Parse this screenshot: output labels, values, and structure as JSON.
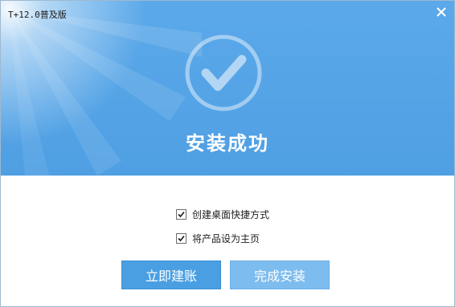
{
  "window": {
    "title": "T+12.0普及版"
  },
  "banner": {
    "headline": "安装成功"
  },
  "options": [
    {
      "label": "创建桌面快捷方式",
      "checked": true
    },
    {
      "label": "将产品设为主页",
      "checked": true
    }
  ],
  "buttons": {
    "create_account": "立即建账",
    "finish": "完成安装"
  },
  "colors": {
    "banner": "#5aa8ea",
    "primary_button": "#4a9fe2",
    "secondary_button": "#7dbcee"
  }
}
